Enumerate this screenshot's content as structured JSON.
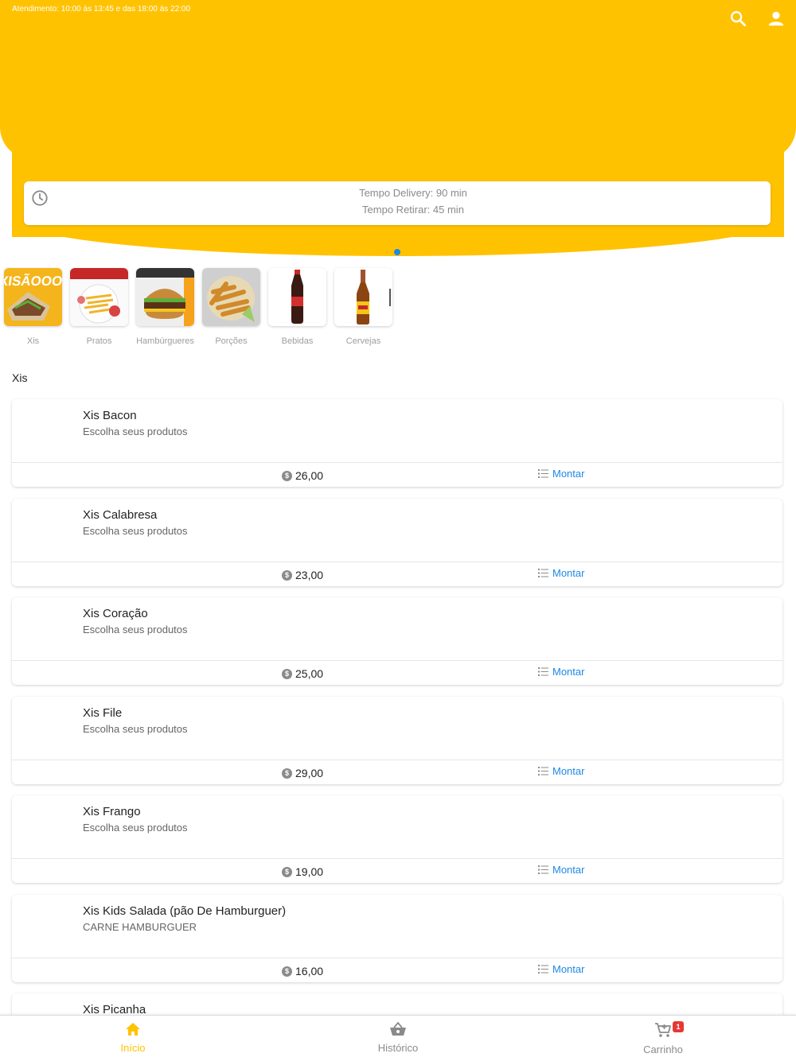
{
  "header": {
    "hours": "Atendimento: 10:00 às 13:45 e das 18:00 às 22:00",
    "delivery_time": "Tempo Delivery: 90 min",
    "pickup_time": "Tempo Retirar: 45 min"
  },
  "categories": [
    {
      "label": "Xis"
    },
    {
      "label": "Pratos"
    },
    {
      "label": "Hambúrgueres"
    },
    {
      "label": "Porções"
    },
    {
      "label": "Bebidas"
    },
    {
      "label": "Cervejas"
    }
  ],
  "section_title": "Xis",
  "currency_symbol": "$",
  "action_label": "Montar",
  "products": [
    {
      "name": "Xis Bacon",
      "desc": "Escolha seus produtos",
      "price": "26,00"
    },
    {
      "name": "Xis Calabresa",
      "desc": "Escolha seus produtos",
      "price": "23,00"
    },
    {
      "name": "Xis Coração",
      "desc": "Escolha seus produtos",
      "price": "25,00"
    },
    {
      "name": "Xis File",
      "desc": "Escolha seus produtos",
      "price": "29,00"
    },
    {
      "name": "Xis Frango",
      "desc": "Escolha seus produtos",
      "price": "19,00"
    },
    {
      "name": "Xis Kids Salada (pão De Hamburguer)",
      "desc": "CARNE HAMBURGUER",
      "price": "16,00"
    },
    {
      "name": "Xis Picanha",
      "desc": "",
      "price": ""
    }
  ],
  "nav": {
    "home": "Início",
    "history": "Histórico",
    "cart": "Carrinho",
    "cart_count": "1"
  },
  "colors": {
    "brand": "#ffc200",
    "accent": "#1e88e5",
    "badge": "#e53935"
  },
  "icons": {
    "search": "search-icon",
    "user": "user-icon",
    "clock": "clock-icon",
    "home": "home-icon",
    "history": "basket-icon",
    "cart": "cart-icon"
  }
}
